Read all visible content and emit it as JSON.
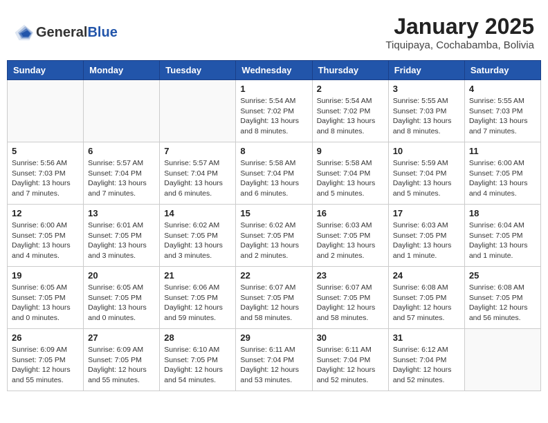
{
  "header": {
    "logo_general": "General",
    "logo_blue": "Blue",
    "month_year": "January 2025",
    "location": "Tiquipaya, Cochabamba, Bolivia"
  },
  "weekdays": [
    "Sunday",
    "Monday",
    "Tuesday",
    "Wednesday",
    "Thursday",
    "Friday",
    "Saturday"
  ],
  "weeks": [
    [
      {
        "day": "",
        "info": ""
      },
      {
        "day": "",
        "info": ""
      },
      {
        "day": "",
        "info": ""
      },
      {
        "day": "1",
        "info": "Sunrise: 5:54 AM\nSunset: 7:02 PM\nDaylight: 13 hours and 8 minutes."
      },
      {
        "day": "2",
        "info": "Sunrise: 5:54 AM\nSunset: 7:02 PM\nDaylight: 13 hours and 8 minutes."
      },
      {
        "day": "3",
        "info": "Sunrise: 5:55 AM\nSunset: 7:03 PM\nDaylight: 13 hours and 8 minutes."
      },
      {
        "day": "4",
        "info": "Sunrise: 5:55 AM\nSunset: 7:03 PM\nDaylight: 13 hours and 7 minutes."
      }
    ],
    [
      {
        "day": "5",
        "info": "Sunrise: 5:56 AM\nSunset: 7:03 PM\nDaylight: 13 hours and 7 minutes."
      },
      {
        "day": "6",
        "info": "Sunrise: 5:57 AM\nSunset: 7:04 PM\nDaylight: 13 hours and 7 minutes."
      },
      {
        "day": "7",
        "info": "Sunrise: 5:57 AM\nSunset: 7:04 PM\nDaylight: 13 hours and 6 minutes."
      },
      {
        "day": "8",
        "info": "Sunrise: 5:58 AM\nSunset: 7:04 PM\nDaylight: 13 hours and 6 minutes."
      },
      {
        "day": "9",
        "info": "Sunrise: 5:58 AM\nSunset: 7:04 PM\nDaylight: 13 hours and 5 minutes."
      },
      {
        "day": "10",
        "info": "Sunrise: 5:59 AM\nSunset: 7:04 PM\nDaylight: 13 hours and 5 minutes."
      },
      {
        "day": "11",
        "info": "Sunrise: 6:00 AM\nSunset: 7:05 PM\nDaylight: 13 hours and 4 minutes."
      }
    ],
    [
      {
        "day": "12",
        "info": "Sunrise: 6:00 AM\nSunset: 7:05 PM\nDaylight: 13 hours and 4 minutes."
      },
      {
        "day": "13",
        "info": "Sunrise: 6:01 AM\nSunset: 7:05 PM\nDaylight: 13 hours and 3 minutes."
      },
      {
        "day": "14",
        "info": "Sunrise: 6:02 AM\nSunset: 7:05 PM\nDaylight: 13 hours and 3 minutes."
      },
      {
        "day": "15",
        "info": "Sunrise: 6:02 AM\nSunset: 7:05 PM\nDaylight: 13 hours and 2 minutes."
      },
      {
        "day": "16",
        "info": "Sunrise: 6:03 AM\nSunset: 7:05 PM\nDaylight: 13 hours and 2 minutes."
      },
      {
        "day": "17",
        "info": "Sunrise: 6:03 AM\nSunset: 7:05 PM\nDaylight: 13 hours and 1 minute."
      },
      {
        "day": "18",
        "info": "Sunrise: 6:04 AM\nSunset: 7:05 PM\nDaylight: 13 hours and 1 minute."
      }
    ],
    [
      {
        "day": "19",
        "info": "Sunrise: 6:05 AM\nSunset: 7:05 PM\nDaylight: 13 hours and 0 minutes."
      },
      {
        "day": "20",
        "info": "Sunrise: 6:05 AM\nSunset: 7:05 PM\nDaylight: 13 hours and 0 minutes."
      },
      {
        "day": "21",
        "info": "Sunrise: 6:06 AM\nSunset: 7:05 PM\nDaylight: 12 hours and 59 minutes."
      },
      {
        "day": "22",
        "info": "Sunrise: 6:07 AM\nSunset: 7:05 PM\nDaylight: 12 hours and 58 minutes."
      },
      {
        "day": "23",
        "info": "Sunrise: 6:07 AM\nSunset: 7:05 PM\nDaylight: 12 hours and 58 minutes."
      },
      {
        "day": "24",
        "info": "Sunrise: 6:08 AM\nSunset: 7:05 PM\nDaylight: 12 hours and 57 minutes."
      },
      {
        "day": "25",
        "info": "Sunrise: 6:08 AM\nSunset: 7:05 PM\nDaylight: 12 hours and 56 minutes."
      }
    ],
    [
      {
        "day": "26",
        "info": "Sunrise: 6:09 AM\nSunset: 7:05 PM\nDaylight: 12 hours and 55 minutes."
      },
      {
        "day": "27",
        "info": "Sunrise: 6:09 AM\nSunset: 7:05 PM\nDaylight: 12 hours and 55 minutes."
      },
      {
        "day": "28",
        "info": "Sunrise: 6:10 AM\nSunset: 7:05 PM\nDaylight: 12 hours and 54 minutes."
      },
      {
        "day": "29",
        "info": "Sunrise: 6:11 AM\nSunset: 7:04 PM\nDaylight: 12 hours and 53 minutes."
      },
      {
        "day": "30",
        "info": "Sunrise: 6:11 AM\nSunset: 7:04 PM\nDaylight: 12 hours and 52 minutes."
      },
      {
        "day": "31",
        "info": "Sunrise: 6:12 AM\nSunset: 7:04 PM\nDaylight: 12 hours and 52 minutes."
      },
      {
        "day": "",
        "info": ""
      }
    ]
  ]
}
